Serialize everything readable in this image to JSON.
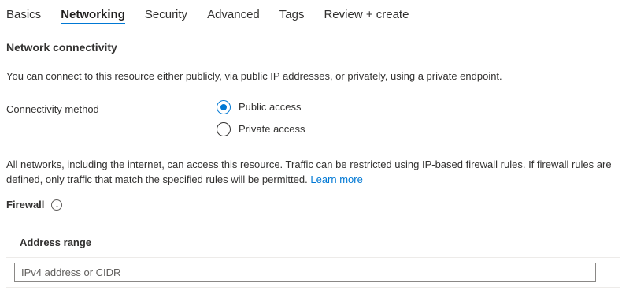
{
  "tabs": [
    {
      "label": "Basics",
      "active": false
    },
    {
      "label": "Networking",
      "active": true
    },
    {
      "label": "Security",
      "active": false
    },
    {
      "label": "Advanced",
      "active": false
    },
    {
      "label": "Tags",
      "active": false
    },
    {
      "label": "Review + create",
      "active": false
    }
  ],
  "section": {
    "title": "Network connectivity",
    "intro": "You can connect to this resource either publicly, via public IP addresses, or privately, using a private endpoint."
  },
  "connectivity": {
    "label": "Connectivity method",
    "options": [
      {
        "label": "Public access",
        "checked": true
      },
      {
        "label": "Private access",
        "checked": false
      }
    ]
  },
  "description": {
    "text": "All networks, including the internet, can access this resource. Traffic can be restricted using IP-based firewall rules. If firewall rules are defined, only traffic that match the specified rules will be permitted.",
    "link": "Learn more"
  },
  "firewall": {
    "label": "Firewall",
    "info_icon": "info-icon",
    "info_glyph": "i",
    "column_header": "Address range",
    "input_value": "",
    "input_placeholder": "IPv4 address or CIDR"
  },
  "colors": {
    "accent": "#0078d4",
    "text": "#323130",
    "border": "#8a8886"
  }
}
